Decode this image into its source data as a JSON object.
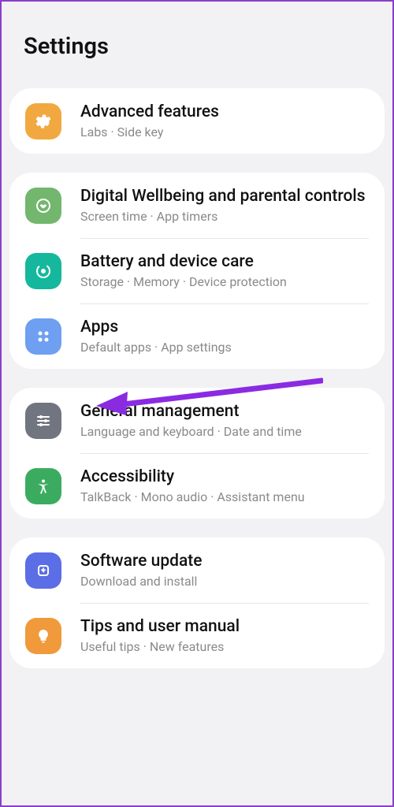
{
  "header": {
    "title": "Settings"
  },
  "groups": [
    [
      {
        "title": "Advanced features",
        "sub": "Labs  ·  Side key"
      }
    ],
    [
      {
        "title": "Digital Wellbeing and parental controls",
        "sub": "Screen time  ·  App timers"
      },
      {
        "title": "Battery and device care",
        "sub": "Storage  ·  Memory  ·  Device protection"
      },
      {
        "title": "Apps",
        "sub": "Default apps  ·  App settings"
      }
    ],
    [
      {
        "title": "General management",
        "sub": "Language and keyboard  ·  Date and time"
      },
      {
        "title": "Accessibility",
        "sub": "TalkBack  ·  Mono audio  ·  Assistant menu"
      }
    ],
    [
      {
        "title": "Software update",
        "sub": "Download and install"
      },
      {
        "title": "Tips and user manual",
        "sub": "Useful tips  ·  New features"
      }
    ]
  ]
}
